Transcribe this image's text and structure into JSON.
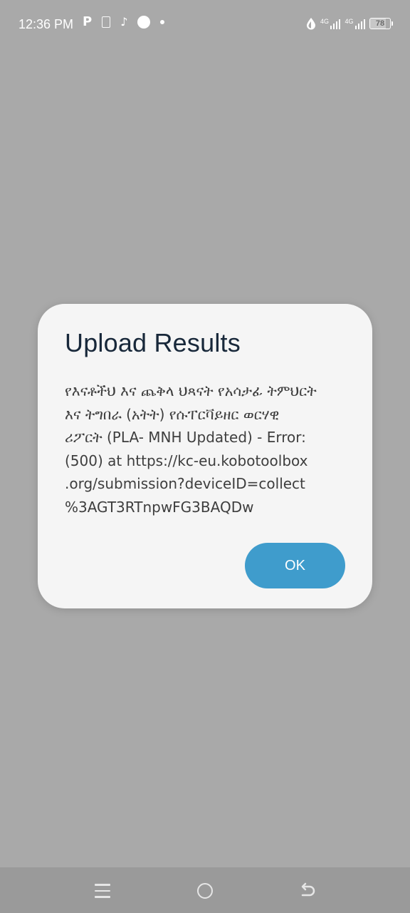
{
  "status_bar": {
    "time": "12:36 PM",
    "left_icons": [
      "parking-app-icon",
      "document-icon",
      "tiktok-icon",
      "circle-icon",
      "dot-icon"
    ],
    "network_1_label": "4G",
    "network_2_label": "4G",
    "battery_level": "78",
    "battery_fraction": 0.78
  },
  "dialog": {
    "title": "Upload Results",
    "message": "የእናቶችህ እና ጨቅላ ህጻናት የአሳታፊ ትምህርት\nእና ትግበራ (አትት) የሱፐርቫይዘር ወርሃዊ\nሪፖርት (PLA- MNH Updated) - Error:\n(500) at https://kc-eu.kobotoolbox\n.org/submission?deviceID=collect\n%3AGT3RTnpwFG3BAQDw",
    "ok_label": "OK",
    "accent_color": "#3f9ccc"
  },
  "navigation_bar": {
    "buttons": [
      "menu-icon",
      "home-icon",
      "back-icon"
    ]
  }
}
